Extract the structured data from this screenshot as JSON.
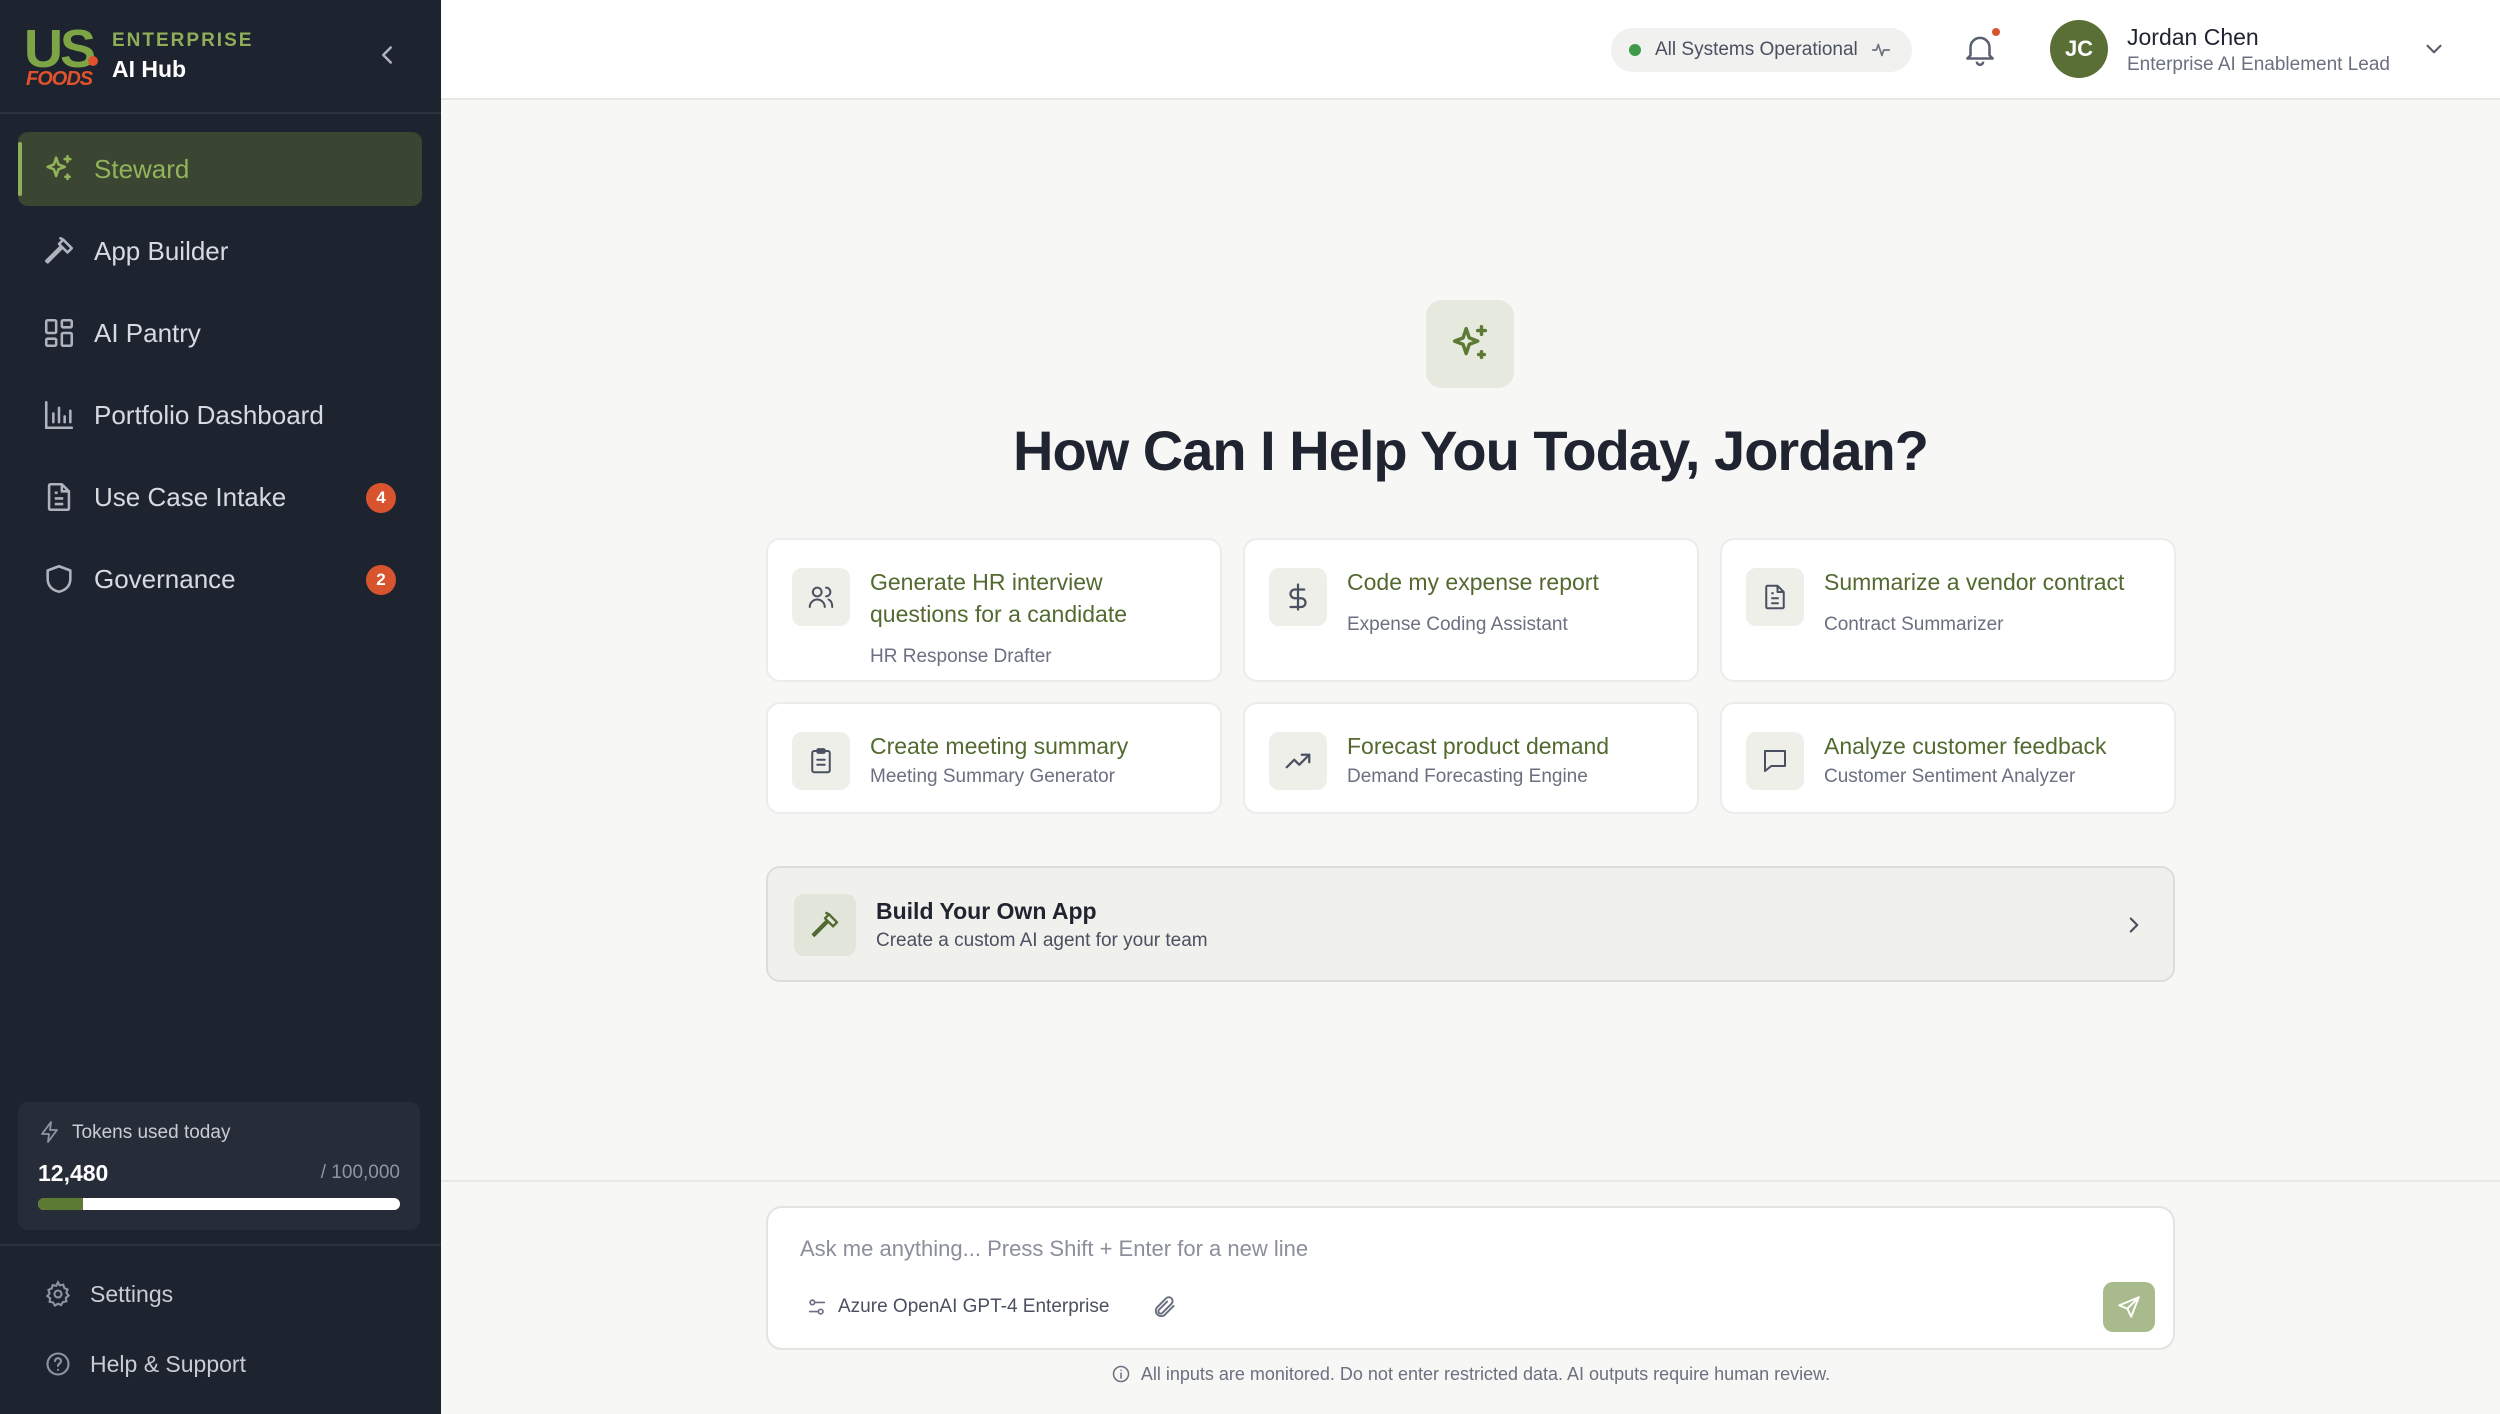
{
  "brand": {
    "logo_us": "US",
    "logo_foods": "FOODS",
    "tagline": "ENTERPRISE",
    "product": "AI Hub"
  },
  "nav": {
    "items": [
      {
        "label": "Steward",
        "icon": "sparkle-icon",
        "active": true
      },
      {
        "label": "App Builder",
        "icon": "hammer-icon"
      },
      {
        "label": "AI Pantry",
        "icon": "grid-icon"
      },
      {
        "label": "Portfolio Dashboard",
        "icon": "bar-chart-icon"
      },
      {
        "label": "Use Case Intake",
        "icon": "document-icon",
        "badge": "4"
      },
      {
        "label": "Governance",
        "icon": "shield-icon",
        "badge": "2"
      }
    ]
  },
  "tokens": {
    "label": "Tokens used today",
    "used": "12,480",
    "total": "/ 100,000",
    "fraction": 0.1248
  },
  "footer_links": {
    "settings": "Settings",
    "help": "Help & Support"
  },
  "header": {
    "status": "All Systems Operational",
    "user": {
      "initials": "JC",
      "name": "Jordan Chen",
      "role": "Enterprise AI Enablement Lead"
    }
  },
  "hero": {
    "title": "How Can I Help You Today, Jordan?"
  },
  "suggestions": [
    {
      "title": "Generate HR interview questions for a candidate",
      "subtitle": "HR Response Drafter",
      "icon": "users-icon"
    },
    {
      "title": "Code my expense report",
      "subtitle": "Expense Coding Assistant",
      "icon": "dollar-icon"
    },
    {
      "title": "Summarize a vendor contract",
      "subtitle": "Contract Summarizer",
      "icon": "file-text-icon"
    },
    {
      "title": "Create meeting summary",
      "subtitle": "Meeting Summary Generator",
      "icon": "clipboard-icon"
    },
    {
      "title": "Forecast product demand",
      "subtitle": "Demand Forecasting Engine",
      "icon": "trending-up-icon"
    },
    {
      "title": "Analyze customer feedback",
      "subtitle": "Customer Sentiment Analyzer",
      "icon": "message-icon"
    }
  ],
  "build": {
    "title": "Build Your Own App",
    "subtitle": "Create a custom AI agent for your team"
  },
  "composer": {
    "placeholder": "Ask me anything... Press Shift + Enter for a new line",
    "value": "",
    "model": "Azure OpenAI GPT-4 Enterprise"
  },
  "disclaimer": "All inputs are monitored. Do not enter restricted data. AI outputs require human review."
}
